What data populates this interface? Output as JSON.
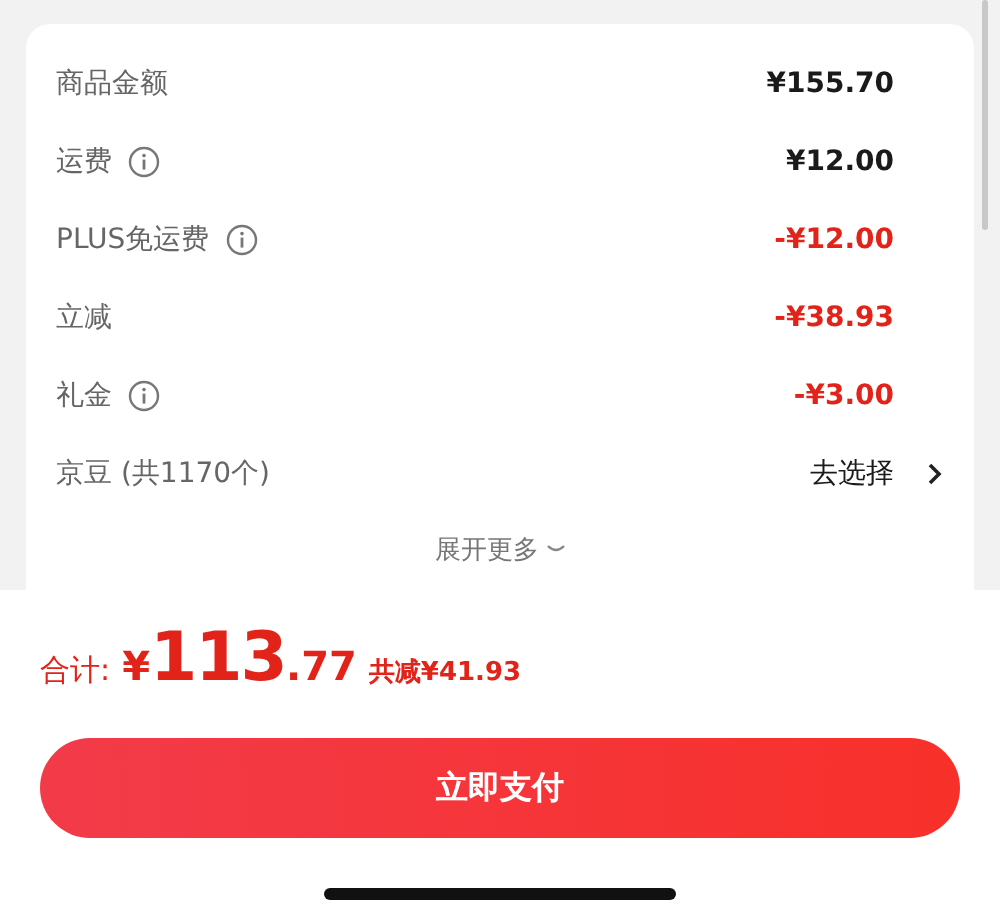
{
  "summary": {
    "rows": [
      {
        "kind": "amount",
        "label": "商品金额",
        "info": false,
        "value": "¥155.70",
        "highlight": false
      },
      {
        "kind": "amount",
        "label": "运费",
        "info": true,
        "value": "¥12.00",
        "highlight": false
      },
      {
        "kind": "amount",
        "label": "PLUS免运费",
        "info": true,
        "value": "-¥12.00",
        "highlight": true
      },
      {
        "kind": "amount",
        "label": "立减",
        "info": false,
        "value": "-¥38.93",
        "highlight": true
      },
      {
        "kind": "amount",
        "label": "礼金",
        "info": true,
        "value": "-¥3.00",
        "highlight": true
      },
      {
        "kind": "link",
        "label": "京豆 (共1170个)",
        "info": false,
        "value": "去选择"
      }
    ],
    "expand": "展开更多"
  },
  "total": {
    "label": "合计:",
    "currency": "¥",
    "integer": "113",
    "decimal": ".77",
    "savings": "共减¥41.93"
  },
  "pay_button": "立即支付"
}
